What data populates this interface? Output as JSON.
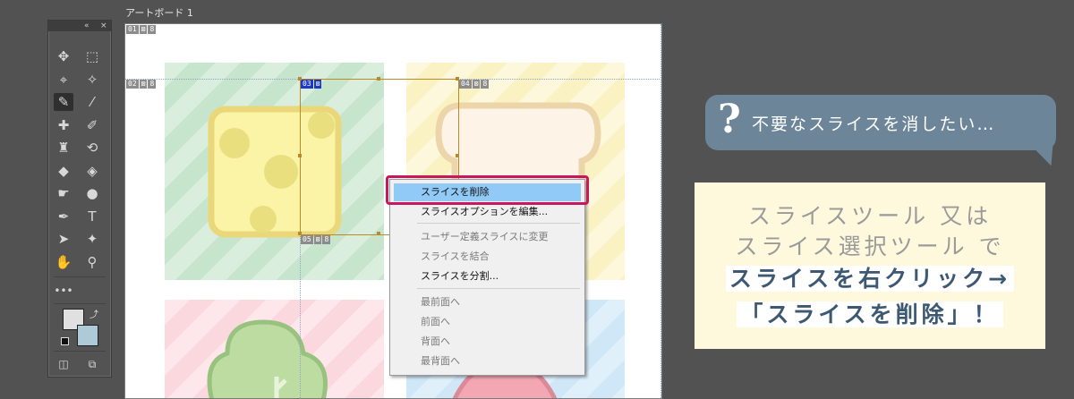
{
  "artboard": {
    "title": "アートボード 1"
  },
  "slices": [
    {
      "num": "01"
    },
    {
      "num": "02"
    },
    {
      "num": "03"
    },
    {
      "num": "04"
    },
    {
      "num": "05"
    }
  ],
  "toolbar": {
    "collapse_icon": "«",
    "close_icon": "×",
    "tools": [
      {
        "name": "move-icon",
        "glyph": "✥"
      },
      {
        "name": "marquee-icon",
        "glyph": "⬚"
      },
      {
        "name": "lasso-icon",
        "glyph": "⌖"
      },
      {
        "name": "magic-wand-icon",
        "glyph": "✧"
      },
      {
        "name": "slice-icon",
        "glyph": "✎"
      },
      {
        "name": "eyedropper-icon",
        "glyph": "⁄"
      },
      {
        "name": "healing-brush-icon",
        "glyph": "✚"
      },
      {
        "name": "brush-icon",
        "glyph": "✐"
      },
      {
        "name": "clone-stamp-icon",
        "glyph": "♜"
      },
      {
        "name": "history-brush-icon",
        "glyph": "⟲"
      },
      {
        "name": "eraser-icon",
        "glyph": "◆"
      },
      {
        "name": "paint-bucket-icon",
        "glyph": "◈"
      },
      {
        "name": "smudge-icon",
        "glyph": "☛"
      },
      {
        "name": "dodge-icon",
        "glyph": "●"
      },
      {
        "name": "pen-icon",
        "glyph": "✒"
      },
      {
        "name": "type-icon",
        "glyph": "T"
      },
      {
        "name": "path-selection-icon",
        "glyph": "➤"
      },
      {
        "name": "shape-icon",
        "glyph": "✦"
      },
      {
        "name": "hand-icon",
        "glyph": "✋"
      },
      {
        "name": "zoom-icon",
        "glyph": "⚲"
      }
    ],
    "more": "•••",
    "foreground_color": "#e0e0e0",
    "background_color": "#aec9d8"
  },
  "context_menu": {
    "items": [
      {
        "label": "スライスを削除",
        "enabled": true,
        "highlighted": true
      },
      {
        "label": "スライスオプションを編集...",
        "enabled": true
      },
      {
        "label": "ユーザー定義スライスに変更",
        "enabled": false
      },
      {
        "label": "スライスを結合",
        "enabled": false
      },
      {
        "label": "スライスを分割...",
        "enabled": true
      },
      {
        "label": "最前面へ",
        "enabled": false
      },
      {
        "label": "前面へ",
        "enabled": false
      },
      {
        "label": "背面へ",
        "enabled": false
      },
      {
        "label": "最背面へ",
        "enabled": false
      }
    ]
  },
  "annotation": {
    "question_mark": "?",
    "bubble_text": "不要なスライスを消したい…",
    "line1": "スライスツール 又は",
    "line2": "スライス選択ツール で",
    "line3": "スライスを右クリック→",
    "line4": "「スライスを削除」！"
  },
  "colors": {
    "highlight": "#91c9f7",
    "ring": "#c8175a",
    "bubble": "#6c8599",
    "note_bg": "#fef9dd",
    "accent_text": "#3c5872"
  }
}
